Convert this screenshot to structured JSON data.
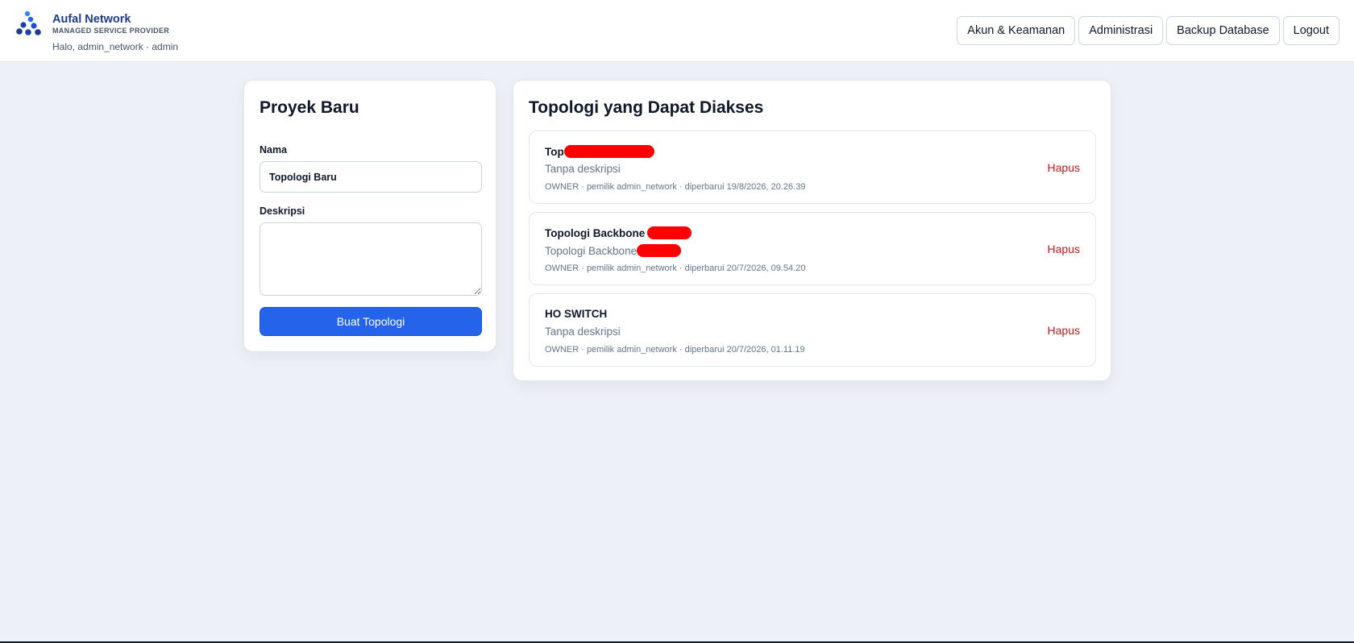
{
  "header": {
    "logo_icon": "network-nodes-logo",
    "brand_name": "Aufal Network",
    "brand_subtitle": "MANAGED SERVICE PROVIDER",
    "greeting": "Halo, admin_network · admin",
    "nav": [
      {
        "label": "Akun & Keamanan"
      },
      {
        "label": "Administrasi"
      },
      {
        "label": "Backup Database"
      },
      {
        "label": "Logout"
      }
    ]
  },
  "new_project": {
    "title": "Proyek Baru",
    "name_label": "Nama",
    "name_value": "Topologi Baru",
    "desc_label": "Deskripsi",
    "desc_value": "",
    "submit_label": "Buat Topologi",
    "accent_color": "#2563eb"
  },
  "topologies": {
    "title": "Topologi yang Dapat Diakses",
    "delete_label": "Hapus",
    "delete_color": "#b91c1c",
    "items": [
      {
        "name": "Top",
        "name_redacted": true,
        "description": "Tanpa deskripsi",
        "desc_redacted": false,
        "meta": "OWNER · pemilik admin_network · diperbarui 19/8/2026, 20.26.39"
      },
      {
        "name": "Topologi Backbone",
        "name_redacted": true,
        "description": "Topologi Backbone",
        "desc_redacted": true,
        "meta": "OWNER · pemilik admin_network · diperbarui 20/7/2026, 09.54.20"
      },
      {
        "name": "HO SWITCH",
        "name_redacted": false,
        "description": "Tanpa deskripsi",
        "desc_redacted": false,
        "meta": "OWNER · pemilik admin_network · diperbarui 20/7/2026, 01.11.19"
      }
    ]
  }
}
